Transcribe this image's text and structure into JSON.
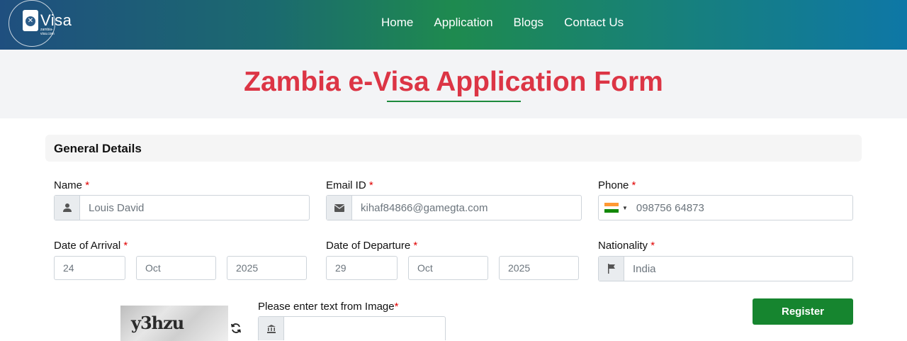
{
  "brand": {
    "logo_word": "Visa",
    "logo_domain": "zambia-visa.com"
  },
  "nav": {
    "items": [
      "Home",
      "Application",
      "Blogs",
      "Contact Us"
    ]
  },
  "page": {
    "title": "Zambia e-Visa Application Form"
  },
  "section": {
    "title": "General Details"
  },
  "fields": {
    "name": {
      "label": "Name",
      "required": "*",
      "value": "Louis David",
      "icon": "user-icon"
    },
    "email": {
      "label": "Email ID",
      "required": "*",
      "value": "kihaf84866@gamegta.com",
      "icon": "envelope-icon"
    },
    "phone": {
      "label": "Phone",
      "required": "*",
      "value": "098756 64873",
      "icon": "india-flag-icon"
    },
    "arrival": {
      "label": "Date of Arrival",
      "required": "*",
      "day": "24",
      "month": "Oct",
      "year": "2025"
    },
    "departure": {
      "label": "Date of Departure",
      "required": "*",
      "day": "29",
      "month": "Oct",
      "year": "2025"
    },
    "nationality": {
      "label": "Nationality",
      "required": "*",
      "value": "India",
      "icon": "flag-icon"
    },
    "captcha": {
      "label": "Please enter text from Image",
      "required": "*",
      "image_text": "y3hzu",
      "value": "",
      "icon": "bank-icon"
    }
  },
  "actions": {
    "register_label": "Register"
  },
  "colors": {
    "title_red": "#dc3545",
    "accent_green": "#16852f",
    "required_red": "#e00000"
  }
}
